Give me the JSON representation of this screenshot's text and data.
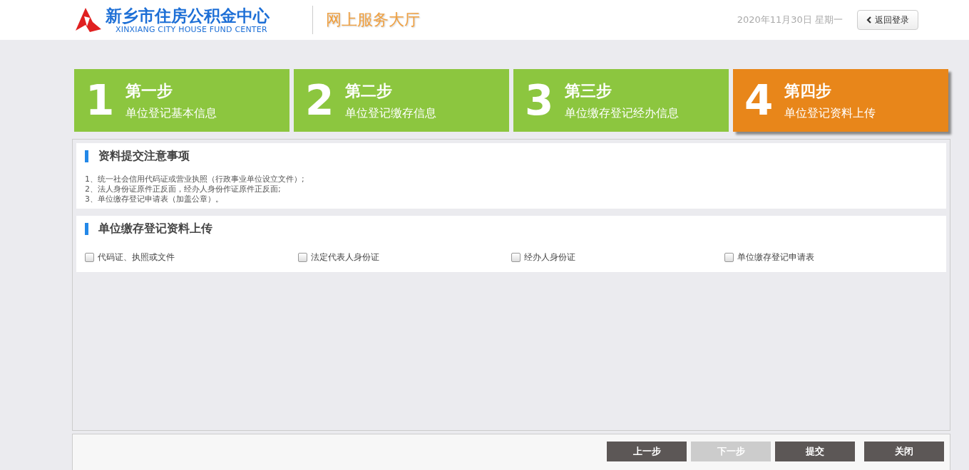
{
  "header": {
    "logo_title": "新乡市住房公积金中心",
    "logo_subtitle": "XINXIANG CITY HOUSE FUND CENTER",
    "portal_title": "网上服务大厅",
    "date": "2020年11月30日 星期一",
    "back_button": "返回登录"
  },
  "steps": [
    {
      "number": "1",
      "title": "第一步",
      "subtitle": "单位登记基本信息",
      "selected": false
    },
    {
      "number": "2",
      "title": "第二步",
      "subtitle": "单位登记缴存信息",
      "selected": false
    },
    {
      "number": "3",
      "title": "第三步",
      "subtitle": "单位缴存登记经办信息",
      "selected": false
    },
    {
      "number": "4",
      "title": "第四步",
      "subtitle": "单位登记资料上传",
      "selected": true
    }
  ],
  "notice": {
    "title": "资料提交注意事项",
    "lines": [
      "1、统一社会信用代码证或营业执照（行政事业单位设立文件）;",
      "2、法人身份证原件正反面，经办人身份作证原件正反面;",
      "3、单位缴存登记申请表（加盖公章）。"
    ]
  },
  "upload": {
    "title": "单位缴存登记资料上传",
    "items": [
      {
        "label": "代码证、执照或文件",
        "checked": false
      },
      {
        "label": "法定代表人身份证",
        "checked": false
      },
      {
        "label": "经办人身份证",
        "checked": false
      },
      {
        "label": "单位缴存登记申请表",
        "checked": false
      }
    ]
  },
  "buttons": [
    {
      "label": "上一步",
      "disabled": false
    },
    {
      "label": "下一步",
      "disabled": true
    },
    {
      "label": "提交",
      "disabled": false
    },
    {
      "label": "关闭",
      "disabled": false
    }
  ]
}
